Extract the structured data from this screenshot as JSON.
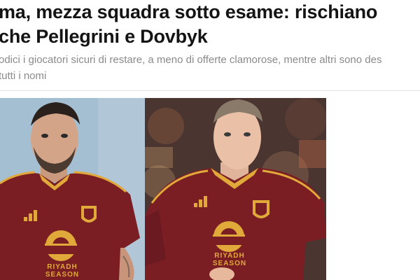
{
  "article": {
    "headline_line1": "ma, mezza squadra sotto esame: rischiano",
    "headline_line2": "che Pellegrini e Dovbyk",
    "subtitle_line1": "odici i giocatori sicuri di restare, a meno di offerte clamorose, mentre altri sono des",
    "subtitle_line2": "tutti i nomi"
  },
  "images": {
    "left_player": {
      "shirt_sponsor": "RIYADH SEASON"
    },
    "right_player": {
      "shirt_sponsor": "RIYADH SEASON"
    }
  },
  "colors": {
    "headline_text": "#141414",
    "subtitle_text": "#8a8a8a",
    "roma_maroon": "#7a1e24",
    "roma_gold": "#e0a93a"
  }
}
